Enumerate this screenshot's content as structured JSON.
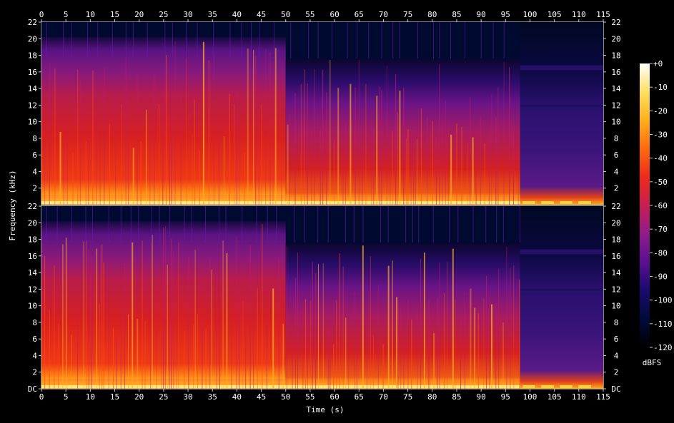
{
  "chart_data": {
    "type": "heatmap",
    "xlabel": "Time (s)",
    "ylabel": "Frequency (kHz)",
    "colorbar_label": "dBFS",
    "xlim": [
      0,
      115
    ],
    "ylim": [
      0,
      22
    ],
    "x_ticks": [
      "0",
      "5",
      "10",
      "15",
      "20",
      "25",
      "30",
      "35",
      "40",
      "45",
      "50",
      "55",
      "60",
      "65",
      "70",
      "75",
      "80",
      "85",
      "90",
      "95",
      "100",
      "105",
      "110",
      "115"
    ],
    "y_ticks_top": [
      "22",
      "20",
      "18",
      "16",
      "14",
      "12",
      "10",
      "8",
      "6",
      "4",
      "2"
    ],
    "y_ticks_bottom": [
      "22",
      "20",
      "18",
      "16",
      "14",
      "12",
      "10",
      "8",
      "6",
      "4",
      "2",
      "DC"
    ],
    "colorbar_ticks": [
      "+0",
      "-10",
      "-20",
      "-30",
      "-40",
      "-50",
      "-60",
      "-70",
      "-80",
      "-90",
      "-100",
      "-110",
      "-120"
    ],
    "colorbar_range": [
      -120,
      0
    ],
    "channels": 2,
    "audio_end_time": 98,
    "full_band_end_time": 50,
    "colors": [
      "#000000",
      "#000a3a",
      "#1a0a6e",
      "#5a1090",
      "#901c8a",
      "#c81e50",
      "#ee2a1c",
      "#ff6a10",
      "#ffb01a",
      "#ffe060",
      "#ffffff"
    ]
  }
}
